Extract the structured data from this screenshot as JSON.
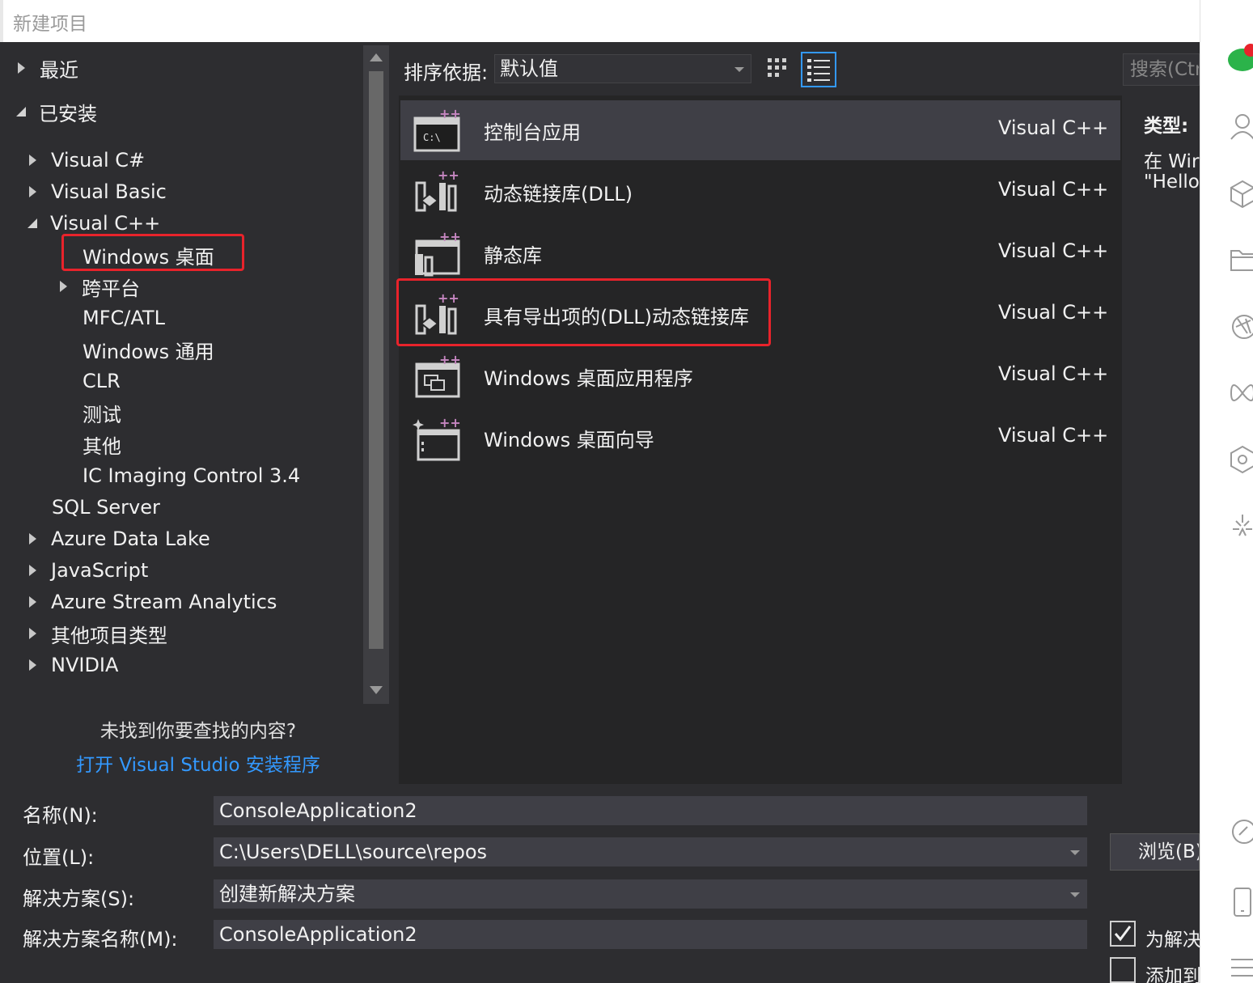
{
  "title": "新建项目",
  "tree": {
    "recent": "最近",
    "installed": "已安装",
    "items": [
      {
        "label": "Visual C#"
      },
      {
        "label": "Visual Basic"
      },
      {
        "label": "Visual C++"
      },
      {
        "label": "Windows 桌面"
      },
      {
        "label": "跨平台"
      },
      {
        "label": "MFC/ATL"
      },
      {
        "label": "Windows 通用"
      },
      {
        "label": "CLR"
      },
      {
        "label": "测试"
      },
      {
        "label": "其他"
      },
      {
        "label": "IC Imaging Control 3.4"
      },
      {
        "label": "SQL Server"
      },
      {
        "label": "Azure Data Lake"
      },
      {
        "label": "JavaScript"
      },
      {
        "label": "Azure Stream Analytics"
      },
      {
        "label": "其他项目类型"
      },
      {
        "label": "NVIDIA"
      }
    ],
    "not_found": "未找到你要查找的内容?",
    "open_installer": "打开 Visual Studio 安装程序"
  },
  "sort": {
    "label": "排序依据:",
    "value": "默认值"
  },
  "search": {
    "placeholder": "搜索(Ctrl+E)"
  },
  "templates": [
    {
      "name": "控制台应用",
      "lang": "Visual C++"
    },
    {
      "name": "动态链接库(DLL)",
      "lang": "Visual C++"
    },
    {
      "name": "静态库",
      "lang": "Visual C++"
    },
    {
      "name": "具有导出项的(DLL)动态链接库",
      "lang": "Visual C++"
    },
    {
      "name": "Windows 桌面应用程序",
      "lang": "Visual C++"
    },
    {
      "name": "Windows 桌面向导",
      "lang": "Visual C++"
    }
  ],
  "info": {
    "type_label": "类型:",
    "desc_line1": "在 Wir",
    "desc_line2": "\"Hello"
  },
  "form": {
    "name_label": "名称(N):",
    "name_value": "ConsoleApplication2",
    "location_label": "位置(L):",
    "location_value": "C:\\Users\\DELL\\source\\repos",
    "solution_label": "解决方案(S):",
    "solution_value": "创建新解决方案",
    "solution_name_label": "解决方案名称(M):",
    "solution_name_value": "ConsoleApplication2",
    "browse": "浏览(B)",
    "create_dir": "为解决",
    "add_to_source": "添加到",
    "create_dir_checked": true,
    "add_to_source_checked": false
  },
  "colors": {
    "accent": "#3399ff",
    "highlight": "#e8232b",
    "background": "#2d2d30",
    "list_background": "#252526"
  }
}
